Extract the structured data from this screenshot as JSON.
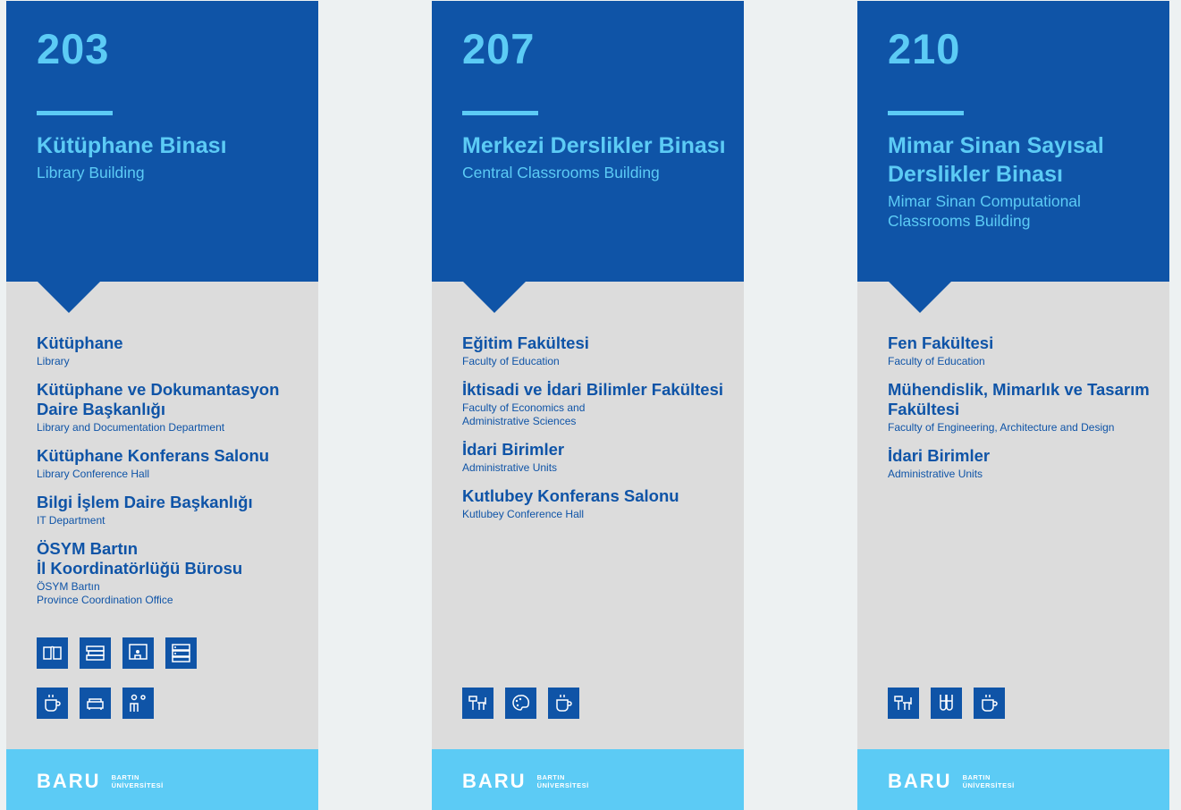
{
  "panels": [
    {
      "number": "203",
      "title": "Kütüphane Binası",
      "subtitle": "Library Building",
      "units": [
        {
          "tr": "Kütüphane",
          "en": "Library"
        },
        {
          "tr": "Kütüphane ve Dokumantasyon Daire Başkanlığı",
          "en": "Library and Documentation Department"
        },
        {
          "tr": "Kütüphane Konferans Salonu",
          "en": "Library Conference Hall"
        },
        {
          "tr": "Bilgi İşlem Daire Başkanlığı",
          "en": "IT Department"
        },
        {
          "tr": "ÖSYM Bartın\nİl Koordinatörlüğü Bürosu",
          "en": "ÖSYM Bartın\nProvince Coordination Office"
        }
      ],
      "icons": [
        [
          "book-icon",
          "books-icon",
          "presentation-icon",
          "server-icon"
        ],
        [
          "cafe-icon",
          "lounge-sofa-icon",
          "reception-icon"
        ]
      ]
    },
    {
      "number": "207",
      "title": "Merkezi Derslikler Binası",
      "subtitle": "Central Classrooms Building",
      "units": [
        {
          "tr": "Eğitim Fakültesi",
          "en": "Faculty of Education"
        },
        {
          "tr": "İktisadi ve İdari Bilimler Fakültesi",
          "en": "Faculty of Economics and\nAdministrative Sciences"
        },
        {
          "tr": "İdari Birimler",
          "en": "Administrative Units"
        },
        {
          "tr": "Kutlubey Konferans Salonu",
          "en": "Kutlubey Conference Hall"
        }
      ],
      "icons": [
        [
          "classroom-icon",
          "art-studio-icon",
          "cafe-icon"
        ]
      ]
    },
    {
      "number": "210",
      "title": "Mimar Sinan Sayısal Derslikler Binası",
      "subtitle": "Mimar Sinan Computational Classrooms Building",
      "units": [
        {
          "tr": "Fen Fakültesi",
          "en": "Faculty of Education"
        },
        {
          "tr": "Mühendislik, Mimarlık ve Tasarım Fakültesi",
          "en": "Faculty of Engineering, Architecture and Design"
        },
        {
          "tr": "İdari Birimler",
          "en": "Administrative Units"
        }
      ],
      "icons": [
        [
          "classroom-icon",
          "laboratory-icon",
          "cafe-icon"
        ]
      ]
    }
  ],
  "logo": {
    "mark": "BARU",
    "line1": "BARTIN",
    "line2": "ÜNİVERSİTESİ"
  },
  "colors": {
    "dark_blue": "#0f54a7",
    "light_blue": "#5ccbf5",
    "grey": "#dcdcdc",
    "background": "#edf1f2"
  }
}
